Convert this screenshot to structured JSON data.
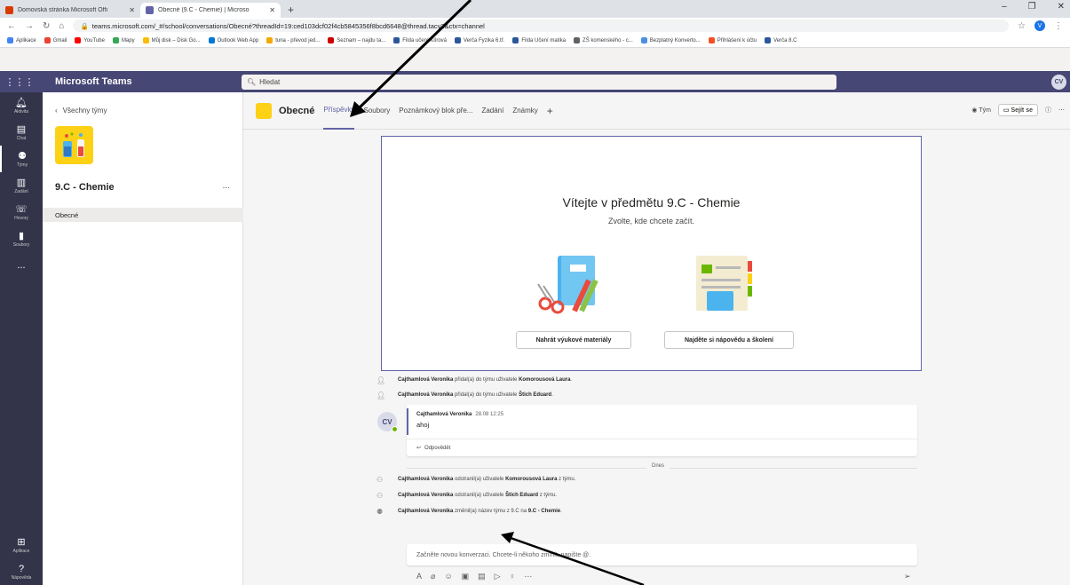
{
  "browser": {
    "tabs": [
      {
        "title": "Domovská stránka Microsoft Offi",
        "color": "#d83b01",
        "active": false
      },
      {
        "title": "Obecné (9.C - Chemie) | Microso",
        "color": "#6264a7",
        "active": true
      }
    ],
    "url": "teams.microsoft.com/_#/school/conversations/Obecné?threadId=19:ced103dcf02f4cb5845356f8bcd6648@thread.tacv2&ctx=channel",
    "profile_initial": "V",
    "bookmarks": [
      {
        "label": "Aplikace",
        "color": "#4285f4"
      },
      {
        "label": "Gmail",
        "color": "#ea4335"
      },
      {
        "label": "YouTube",
        "color": "#ff0000"
      },
      {
        "label": "Mapy",
        "color": "#34a853"
      },
      {
        "label": "Můj disk – Disk Go...",
        "color": "#fbbc04"
      },
      {
        "label": "Outlook Web App",
        "color": "#0078d4"
      },
      {
        "label": "tuna - převod jed...",
        "color": "#f2a900"
      },
      {
        "label": "Seznam – najdu ta...",
        "color": "#cc0000"
      },
      {
        "label": "Filda učení Klírová",
        "color": "#2b579a"
      },
      {
        "label": "Verča Fyzika 6.tř.",
        "color": "#2b579a"
      },
      {
        "label": "Filda Učení matika",
        "color": "#2b579a"
      },
      {
        "label": "ZŠ komenského - c...",
        "color": "#5f6368"
      },
      {
        "label": "Bezplatný Konverto...",
        "color": "#4a90e2"
      },
      {
        "label": "Přihlášení k účtu",
        "color": "#f25022"
      },
      {
        "label": "Verča 8.C",
        "color": "#2b579a"
      }
    ]
  },
  "teams": {
    "app_name": "Microsoft Teams",
    "search_placeholder": "Hledat",
    "user_initials": "CV",
    "rail": [
      {
        "label": "Aktivita",
        "icon": "bell-icon"
      },
      {
        "label": "Chat",
        "icon": "chat-icon"
      },
      {
        "label": "Týmy",
        "icon": "teams-icon"
      },
      {
        "label": "Zadání",
        "icon": "assignments-icon"
      },
      {
        "label": "Hovory",
        "icon": "phone-icon"
      },
      {
        "label": "Soubory",
        "icon": "files-icon"
      }
    ],
    "rail_more": "...",
    "rail_bottom": [
      {
        "label": "Aplikace",
        "icon": "apps-icon"
      },
      {
        "label": "Nápověda",
        "icon": "help-icon"
      }
    ]
  },
  "panel": {
    "back_label": "Všechny týmy",
    "team_name": "9.C - Chemie",
    "more": "...",
    "channel": "Obecné"
  },
  "channel": {
    "name": "Obecné",
    "tabs": [
      "Příspěvky",
      "Soubory",
      "Poznámkový blok pře...",
      "Zadání",
      "Známky"
    ],
    "team_label": "Tým",
    "meet_label": "Sejít se"
  },
  "welcome": {
    "title": "Vítejte v předmětu 9.C - Chemie",
    "subtitle": "Zvolte, kde chcete začít.",
    "button_upload": "Nahrát výukové materiály",
    "button_help": "Najděte si nápovědu a školení"
  },
  "activity": [
    {
      "actor": "Cajthamlová Veronika",
      "text": " přidal(a) do týmu uživatele ",
      "target": "Komorousová Laura",
      "suffix": "."
    },
    {
      "actor": "Cajthamlová Veronika",
      "text": " přidal(a) do týmu uživatele ",
      "target": "Štich Eduard",
      "suffix": "."
    }
  ],
  "post": {
    "author": "Cajthamlová Veronika",
    "time": "28.08 12:25",
    "message": "ahoj",
    "reply_label": "Odpovědět",
    "avatar": "CV"
  },
  "divider_label": "Dnes",
  "activity_today": [
    {
      "actor": "Cajthamlová Veronika",
      "text": " odstranil(a) uživatele ",
      "target": "Komorousová Laura",
      "suffix": " z týmu."
    },
    {
      "actor": "Cajthamlová Veronika",
      "text": " odstranil(a) uživatele ",
      "target": "Štich Eduard",
      "suffix": " z týmu."
    },
    {
      "actor": "Cajthamlová Veronika",
      "text": " změnil(a) název týmu z 9.C na ",
      "target": "9.C - Chemie",
      "suffix": "."
    }
  ],
  "compose": {
    "placeholder": "Začněte novou konverzaci. Chcete-li někoho zmínit, napište @."
  }
}
